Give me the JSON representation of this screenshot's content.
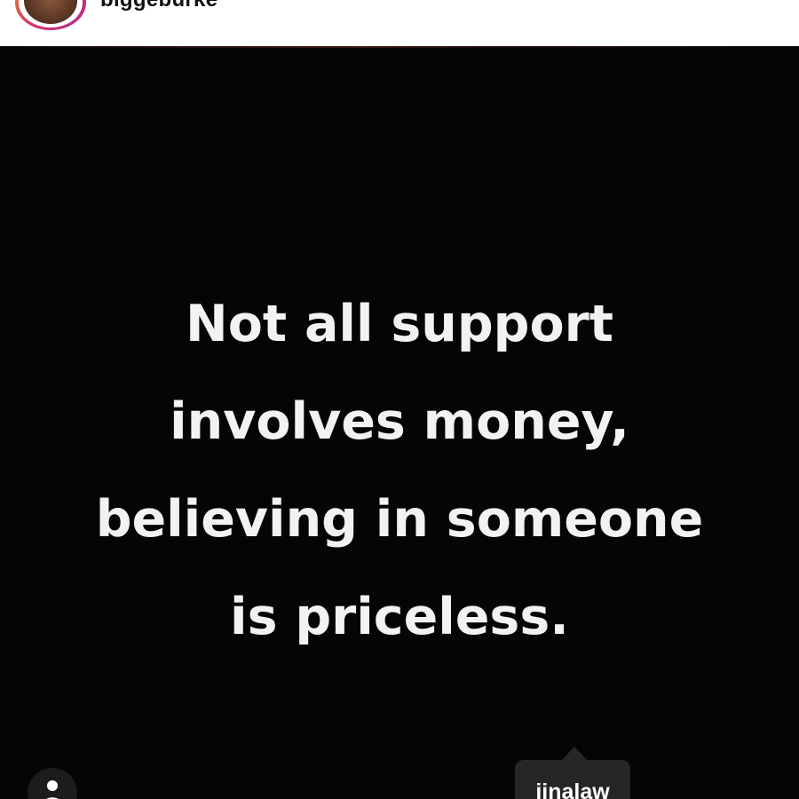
{
  "header": {
    "username": "biggeburke",
    "ring_colors": [
      "#e0882f",
      "#d62f6a",
      "#b02d8a"
    ]
  },
  "post": {
    "background_color": "#050505",
    "quote_lines": [
      "Not all support",
      "involves money,",
      "believing in someone",
      "is priceless."
    ]
  },
  "overlay": {
    "user_tag_icon": "person-icon",
    "tag_label": "jinalaw"
  }
}
